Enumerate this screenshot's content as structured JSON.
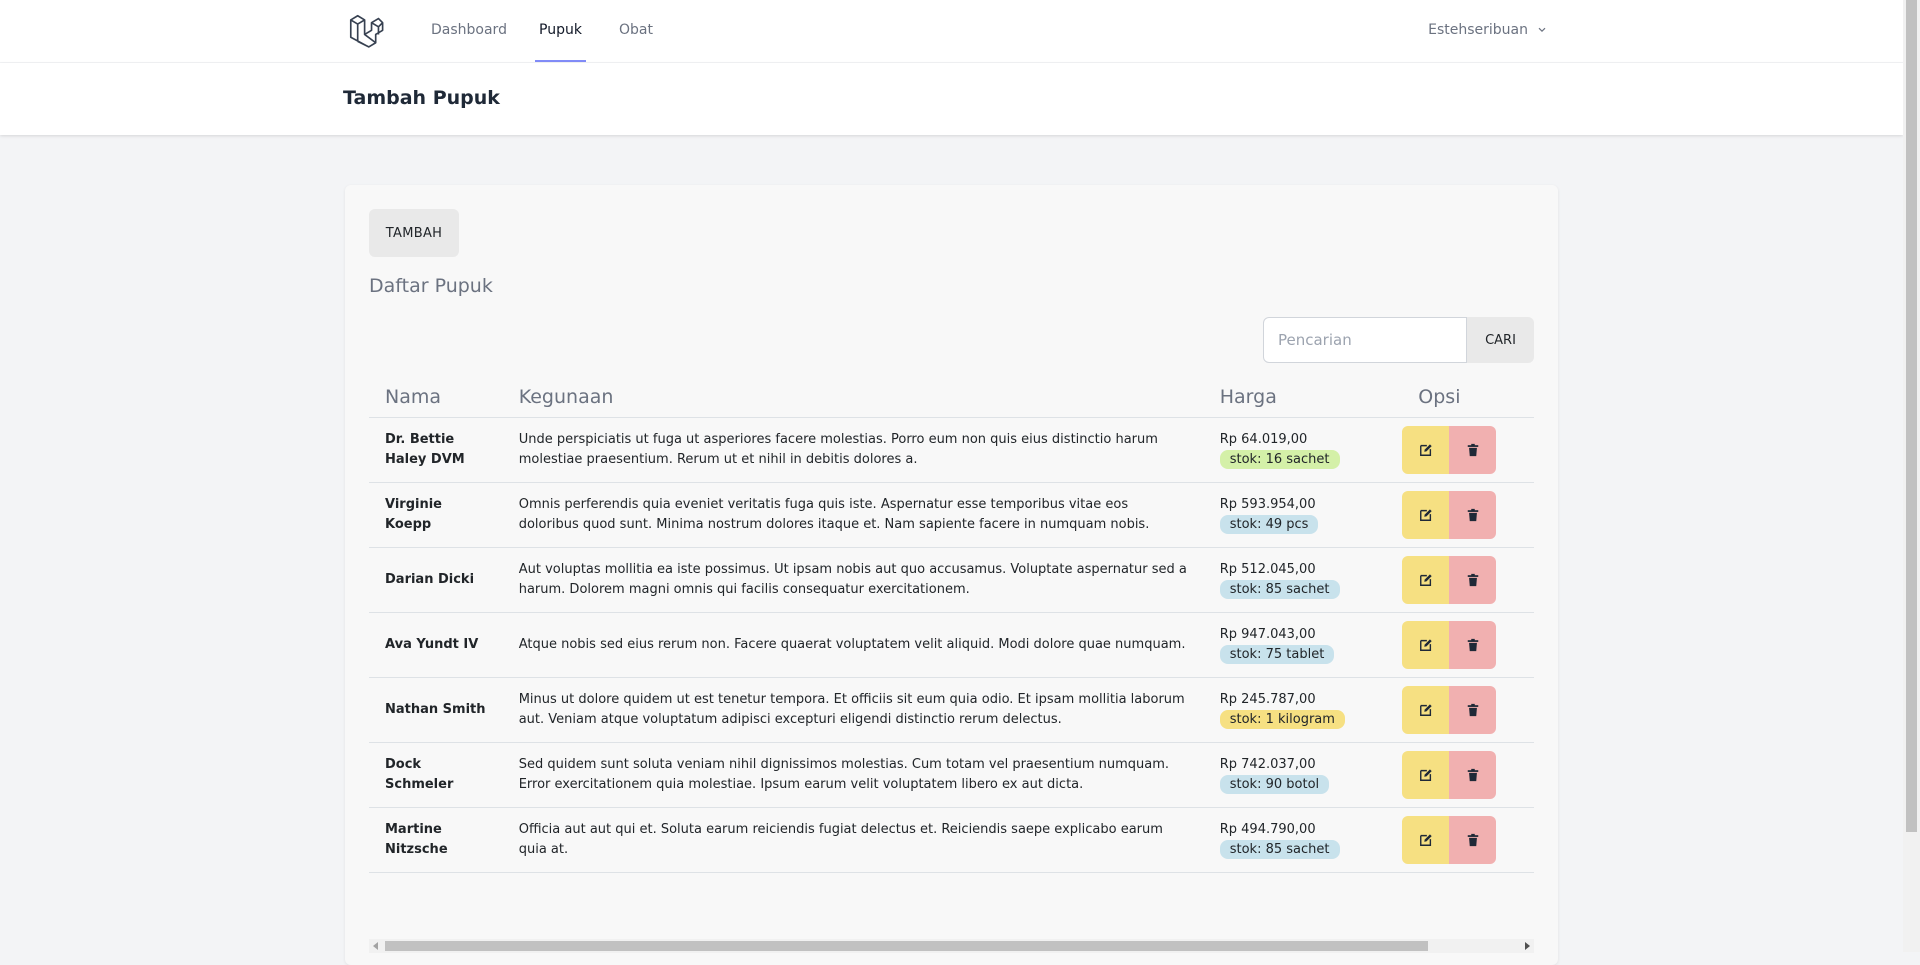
{
  "nav": {
    "links": [
      "Dashboard",
      "Pupuk",
      "Obat"
    ],
    "active": "Pupuk",
    "user": "Estehseribuan"
  },
  "header": {
    "title": "Tambah Pupuk"
  },
  "card": {
    "add_label": "TAMBAH",
    "title": "Daftar Pupuk",
    "search_placeholder": "Pencarian",
    "search_label": "CARI"
  },
  "table": {
    "columns": [
      "Nama",
      "Kegunaan",
      "Harga",
      "Opsi"
    ],
    "rows": [
      {
        "name": "Dr. Bettie Haley DVM",
        "use": "Unde perspiciatis ut fuga ut asperiores facere molestias. Porro eum non quis eius distinctio harum molestiae praesentium. Rerum ut et nihil in debitis dolores a.",
        "price": "Rp 64.019,00",
        "stock": "stok: 16 sachet",
        "stock_color": "#d4f0a8"
      },
      {
        "name": "Virginie Koepp",
        "use": "Omnis perferendis quia eveniet veritatis fuga quis iste. Aspernatur esse temporibus vitae eos doloribus quod sunt. Minima nostrum dolores itaque et. Nam sapiente facere in numquam nobis.",
        "price": "Rp 593.954,00",
        "stock": "stok: 49 pcs",
        "stock_color": "#c8e2ec"
      },
      {
        "name": "Darian Dicki",
        "use": "Aut voluptas mollitia ea iste possimus. Ut ipsam nobis aut quo accusamus. Voluptate aspernatur sed a harum. Dolorem magni omnis qui facilis consequatur exercitationem.",
        "price": "Rp 512.045,00",
        "stock": "stok: 85 sachet",
        "stock_color": "#c8e2ec"
      },
      {
        "name": "Ava Yundt IV",
        "use": "Atque nobis sed eius rerum non. Facere quaerat voluptatem velit aliquid. Modi dolore quae numquam.",
        "price": "Rp 947.043,00",
        "stock": "stok: 75 tablet",
        "stock_color": "#c8e2ec"
      },
      {
        "name": "Nathan Smith",
        "use": "Minus ut dolore quidem ut est tenetur tempora. Et officiis sit eum quia odio. Et ipsam mollitia laborum aut. Veniam atque voluptatum adipisci excepturi eligendi distinctio rerum delectus.",
        "price": "Rp 245.787,00",
        "stock": "stok: 1 kilogram",
        "stock_color": "#f6e082"
      },
      {
        "name": "Dock Schmeler",
        "use": "Sed quidem sunt soluta veniam nihil dignissimos molestias. Cum totam vel praesentium numquam. Error exercitationem quia molestiae. Ipsum earum velit voluptatem libero ex aut dicta.",
        "price": "Rp 742.037,00",
        "stock": "stok: 90 botol",
        "stock_color": "#c8e2ec"
      },
      {
        "name": "Martine Nitzsche",
        "use": "Officia aut aut qui et. Soluta earum reiciendis fugiat delectus et. Reiciendis saepe explicabo earum quia at.",
        "price": "Rp 494.790,00",
        "stock": "stok: 85 sachet",
        "stock_color": "#c8e2ec"
      }
    ]
  },
  "icons": {
    "logo": "laravel-logo-icon",
    "user_menu": "chevron-down-icon",
    "edit": "edit-icon",
    "delete": "trash-icon"
  },
  "colors": {
    "nav_active_underline": "#818cf8",
    "edit_button": "#f6e082",
    "delete_button": "#f1b0b0"
  }
}
